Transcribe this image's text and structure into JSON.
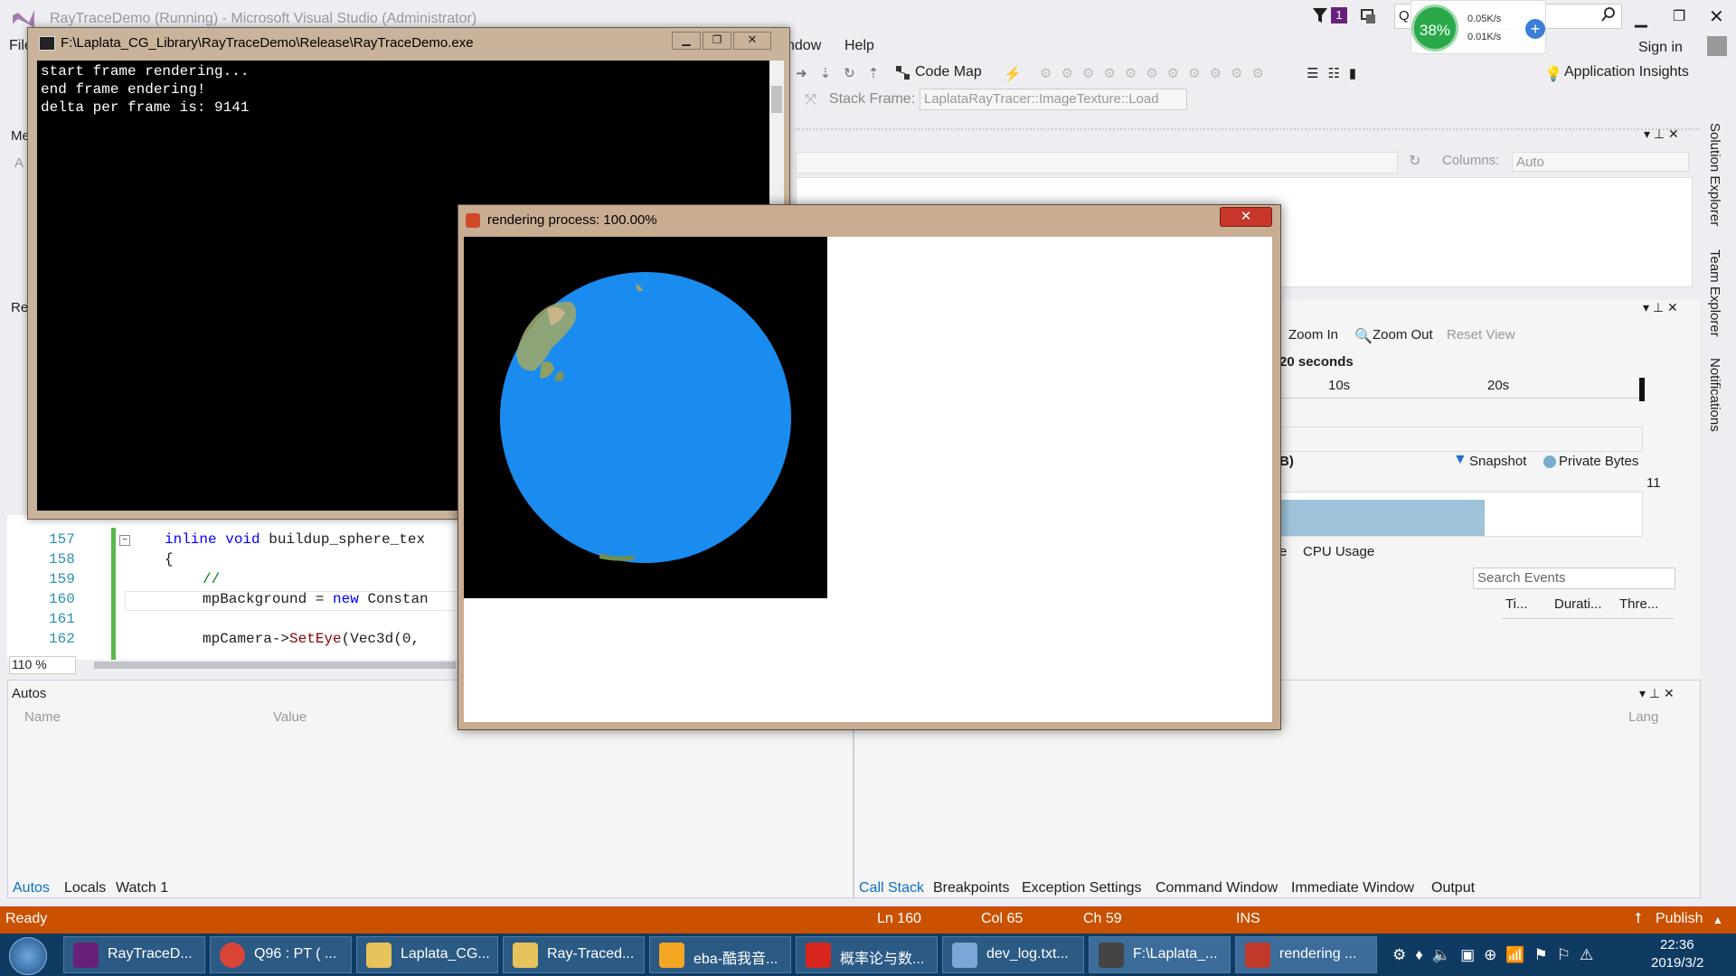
{
  "vs": {
    "title": "RayTraceDemo (Running) - Microsoft Visual Studio (Administrator)",
    "menu": {
      "file": "File",
      "window": "ndow",
      "help": "Help"
    },
    "notification_count": "1",
    "quick_launch_char": "Q",
    "sign_in": "Sign in",
    "toolbar": {
      "code_map": "Code Map",
      "app_insights": "Application Insights",
      "stack_frame_label": "Stack Frame:",
      "stack_frame_value": "LaplataRayTracer::ImageTexture::Load"
    },
    "right_tabs": [
      "Solution Explorer",
      "Team Explorer",
      "Notifications"
    ],
    "columns_label": "Columns:",
    "columns_value": "Auto",
    "diag": {
      "zoom_in": "Zoom In",
      "zoom_out": "Zoom Out",
      "reset_view": "Reset View",
      "seconds": "20 seconds",
      "tick_10": "10s",
      "tick_20": "20s",
      "mem_label": "B)",
      "snapshot": "Snapshot",
      "private_bytes": "Private Bytes",
      "mem_value": "11",
      "tab_partial": "e",
      "cpu_usage": "CPU Usage",
      "search_placeholder": "Search Events",
      "cols": [
        "Ti...",
        "Durati...",
        "Thre..."
      ]
    },
    "left_panel_labels": [
      "Me",
      "A",
      "Re"
    ],
    "code": {
      "lines": [
        {
          "num": "157",
          "text_kw": "inline void",
          "text_rest": " buildup_sphere_tex"
        },
        {
          "num": "158",
          "text": "{"
        },
        {
          "num": "159",
          "comment": "//"
        },
        {
          "num": "160",
          "pre": "mpBackground = ",
          "kw": "new",
          "post": " Constan"
        },
        {
          "num": "161",
          "text": ""
        },
        {
          "num": "162",
          "pre": "mpCamera->",
          "fn": "SetEye",
          "post": "(Vec3d(0,"
        }
      ],
      "zoom": "110 %"
    },
    "autos": {
      "title": "Autos",
      "col_name": "Name",
      "col_value": "Value",
      "col_lang": "Lang",
      "tabs": [
        "Autos",
        "Locals",
        "Watch 1"
      ]
    },
    "bottom_right_tabs": [
      "Call Stack",
      "Breakpoints",
      "Exception Settings",
      "Command Window",
      "Immediate Window",
      "Output"
    ],
    "status": {
      "ready": "Ready",
      "ln": "Ln 160",
      "col": "Col 65",
      "ch": "Ch 59",
      "ins": "INS",
      "publish": "Publish"
    }
  },
  "netmon": {
    "percent": "38%",
    "up": "0.05K/s",
    "down": "0.01K/s"
  },
  "console": {
    "title": "F:\\Laplata_CG_Library\\RayTraceDemo\\Release\\RayTraceDemo.exe",
    "lines": [
      "start frame rendering...",
      "end frame endering!",
      "delta per frame is: 9141"
    ]
  },
  "render": {
    "title": "rendering process: 100.00%"
  },
  "taskbar": {
    "items": [
      {
        "label": "RayTraceD...",
        "color": "#68217a"
      },
      {
        "label": "Q96 : PT ( ...",
        "color": "#db4437"
      },
      {
        "label": "Laplata_CG...",
        "color": "#e8c25a"
      },
      {
        "label": "Ray-Traced...",
        "color": "#e8c25a"
      },
      {
        "label": "eba-酷我音...",
        "color": "#f5a623"
      },
      {
        "label": "概率论与数...",
        "color": "#d9261c"
      },
      {
        "label": "dev_log.txt...",
        "color": "#7aa7d6"
      },
      {
        "label": "F:\\Laplata_...",
        "color": "#444444"
      },
      {
        "label": "rendering ...",
        "color": "#c0392b"
      }
    ],
    "time": "22:36",
    "date": "2019/3/2"
  }
}
